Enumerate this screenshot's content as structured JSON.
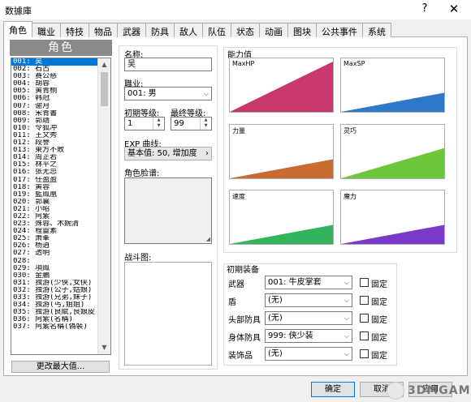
{
  "window": {
    "title": "数據庫",
    "help": "?",
    "close": "✕"
  },
  "tabs": [
    "角色",
    "職业",
    "特技",
    "物品",
    "武器",
    "防具",
    "敌人",
    "队伍",
    "状态",
    "动画",
    "图块",
    "公共事件",
    "系统"
  ],
  "actor_list": {
    "header": "角色",
    "items": [
      "001: 吴",
      "002: 石古",
      "003: 赛公慈",
      "004: 胡蓉",
      "005: 黄青桐",
      "006: 韩冠",
      "007: 谢月",
      "008: 宋青書",
      "009: 郭靖",
      "010: 令狐冲",
      "011: 王文秀",
      "012: 段譽",
      "013: 東方不敗",
      "014: 周芷若",
      "015: 林平之",
      "016: 张无忌",
      "017: 任盈盈",
      "018: 黄蓉",
      "019: 藍鳳凰",
      "020: 郭襄",
      "021: 小昭",
      "022: 阿紫",
      "023: 殊蓉、木婉清",
      "024: 程靈素",
      "025: 萧峯",
      "026: 杨逍",
      "027: 透明",
      "028: ",
      "029: 項鳳",
      "030: 金鵬",
      "031: 独游(少侠,女侠)",
      "032: 独游(公子,姑娘)",
      "033: 独游(兄弟,妹子)",
      "034: 独游(丐,姐姐)",
      "035: 独游(良賦,良娘皮",
      "036: 阿紫(名稱)",
      "037: 阿紫名稱(偽裝)"
    ],
    "max_button": "更改最大值..."
  },
  "form": {
    "name_label": "名称:",
    "name_value": "吴",
    "class_label": "職业:",
    "class_value": "001: 男",
    "init_level_label": "初期等级:",
    "init_level_value": "1",
    "final_level_label": "最终等级:",
    "final_level_value": "99",
    "exp_label": "EXP 曲线:",
    "exp_value": "基本值: 50, 增加度",
    "face_label": "角色脸谱:",
    "battler_label": "战斗图:"
  },
  "capacity": {
    "title": "能力值",
    "charts": [
      {
        "label": "MaxHP",
        "color": "#c8386e",
        "fill_fraction": 1.0
      },
      {
        "label": "MaxSP",
        "color": "#2f78c8",
        "fill_fraction": 0.38
      },
      {
        "label": "力量",
        "color": "#c86c32",
        "fill_fraction": 0.38
      },
      {
        "label": "灵巧",
        "color": "#6cc83a",
        "fill_fraction": 0.6
      },
      {
        "label": "速度",
        "color": "#32b45a",
        "fill_fraction": 0.38
      },
      {
        "label": "魔力",
        "color": "#7a3ac8",
        "fill_fraction": 0.38
      }
    ]
  },
  "equipment": {
    "title": "初期装备",
    "fixed_label": "固定",
    "rows": [
      {
        "label": "武器",
        "value": "001: 牛皮掌套"
      },
      {
        "label": "盾",
        "value": "(无)"
      },
      {
        "label": "头部防具",
        "value": "(无)"
      },
      {
        "label": "身体防具",
        "value": "999: 侠少装"
      },
      {
        "label": "装饰品",
        "value": "(无)"
      }
    ]
  },
  "footer": {
    "ok": "确定",
    "cancel": "取消",
    "apply": "应用"
  },
  "watermark": "3DMGAME"
}
